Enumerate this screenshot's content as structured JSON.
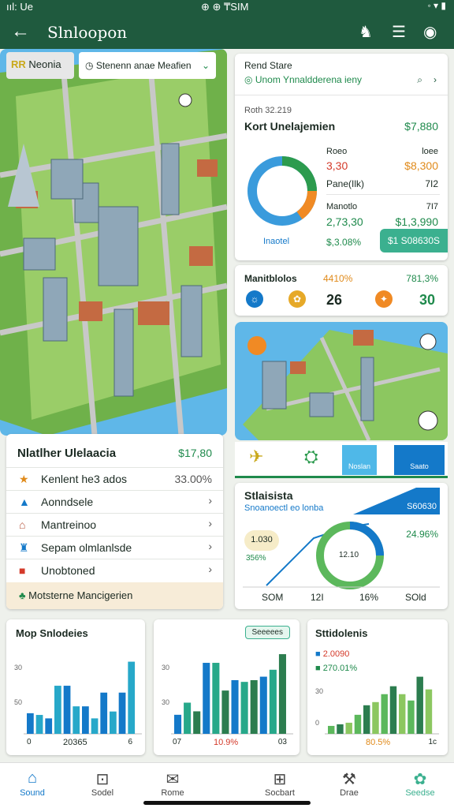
{
  "status": {
    "left": "ııl: Ue",
    "center": "⊕ ⊕ ₸SIM",
    "right": "◦ ▾ ▮"
  },
  "appbar": {
    "title": "Slnloopon",
    "back_label": "←"
  },
  "map_tab": {
    "badge": "RR",
    "label": "Neonia",
    "search": "Stenenn anae Meafien"
  },
  "top_card": {
    "title": "Rend Stare",
    "subtitle": "Unom Ynnaldderena ieny",
    "date": "Roth 32.219",
    "heading": "Kort Unelajemien",
    "heading_value": "$7,880",
    "cols": [
      "Roeo",
      "loee"
    ],
    "v1": "3,30",
    "v1b": "$8,300",
    "v2l": "Pane(Ilk)",
    "v2r": "7I2",
    "v3l": "Manotlo",
    "v3r": "7I7",
    "v4": "2,73,30",
    "v4b": "$1,3,990",
    "legend": "Inaotel",
    "percent": "$,3.08%",
    "btn": "$1 S08630S"
  },
  "kpi": {
    "label": "Manitblolos",
    "p1": "4410%",
    "p2": "781,3%",
    "n1": "26",
    "n2": "30"
  },
  "list_card": {
    "title": "Nlatlher Ulelaacia",
    "value": "$17,80",
    "items": [
      {
        "label": "Kenlent he3 ados",
        "value": "33.00%"
      },
      {
        "label": "Aonndsele",
        "value": "›"
      },
      {
        "label": "Mantreinoo",
        "value": "›"
      },
      {
        "label": "Sepam olmlanlsde",
        "value": "›"
      },
      {
        "label": "Unobtoned",
        "value": "›"
      }
    ],
    "footer": "Motsterne Mancigerien"
  },
  "tabs_strip": {
    "active_label": "Noslan",
    "other_label": "Saato"
  },
  "stats": {
    "title": "Stlaisista",
    "subtitle": "Snoanoectl eo lonba",
    "right": "S60630",
    "p1": "1.030",
    "p2": "356%",
    "p3": "24.96%",
    "center": "12.10",
    "axis": [
      "SOM",
      "12I",
      "16%",
      "SOld"
    ]
  },
  "bottom_cards": [
    {
      "title": "Mop Snlodeies",
      "foot": "20365",
      "axis_top": "30",
      "axis_mid": "50",
      "left": "0",
      "right": "6"
    },
    {
      "title": "",
      "badge": "Seeeees",
      "foot": "10.9%",
      "axis_top": "30",
      "axis_mid": "30",
      "left": "07",
      "right": "03"
    },
    {
      "title": "Sttidolenis",
      "foot": "80.5%",
      "l1": "2.0090",
      "l2": "270.01%",
      "axis_top": "30",
      "axis_mid": "0",
      "right": "1c"
    }
  ],
  "nav": [
    "Sound",
    "Sodel",
    "Rome",
    "Socbart",
    "Drae",
    "Seedse"
  ],
  "colors": {
    "green": "#1f5a3e",
    "accent": "#1479c9",
    "bar1": "#1479c9",
    "bar2": "#27a88a",
    "bar3": "#2c7d4f"
  },
  "chart_data": [
    {
      "type": "bar",
      "values": [
        1.2,
        1.1,
        0.9,
        2.8,
        2.8,
        1.6,
        1.6,
        0.9,
        2.4,
        1.3,
        2.4,
        4.2
      ]
    },
    {
      "type": "bar",
      "values": [
        1.1,
        1.8,
        1.3,
        4.1,
        4.1,
        2.5,
        3.1,
        3.0,
        3.1,
        3.3,
        3.7,
        4.6
      ]
    },
    {
      "type": "bar",
      "values": [
        0.5,
        0.6,
        0.7,
        1.2,
        1.8,
        2.0,
        2.5,
        3.0,
        2.5,
        2.1,
        3.6,
        2.8
      ]
    }
  ]
}
